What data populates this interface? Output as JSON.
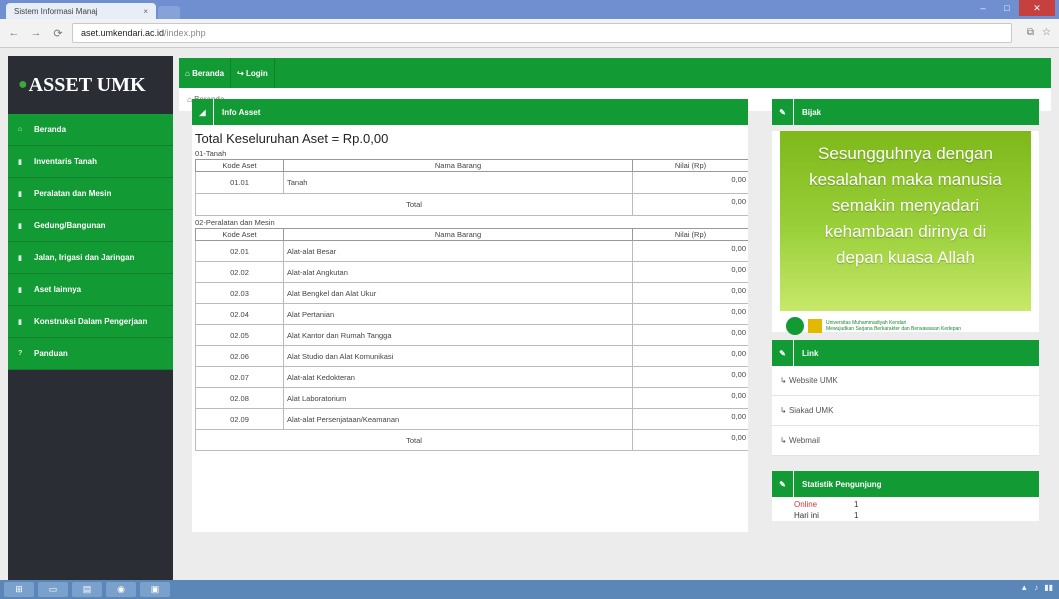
{
  "browser": {
    "tab_title": "Sistem Informasi Manaj",
    "tab_close": "×",
    "url_host": "aset.umkendari.ac.id",
    "url_path": "/index.php"
  },
  "sidebar": {
    "brand": "ASSET UMK",
    "items": [
      {
        "label": "Beranda"
      },
      {
        "label": "Inventaris Tanah"
      },
      {
        "label": "Peralatan dan Mesin"
      },
      {
        "label": "Gedung/Bangunan"
      },
      {
        "label": "Jalan, Irigasi dan Jaringan"
      },
      {
        "label": "Aset lainnya"
      },
      {
        "label": "Konstruksi Dalam Pengerjaan"
      },
      {
        "label": "Panduan"
      }
    ]
  },
  "topnav": {
    "items": [
      {
        "label": "Beranda"
      },
      {
        "label": "Login"
      }
    ]
  },
  "breadcrumb": "Beranda",
  "main": {
    "panel_title": "Info Asset",
    "total_title": "Total Keseluruhan Aset = Rp.0,00",
    "sections": [
      {
        "label": "01-Tanah",
        "headers": [
          "Kode Aset",
          "Nama Barang",
          "Nilai (Rp)"
        ],
        "rows": [
          {
            "kode": "01.01",
            "nama": "Tanah",
            "nilai": "0,00"
          }
        ],
        "total_label": "Total",
        "total_value": "0,00"
      },
      {
        "label": "02-Peralatan dan Mesin",
        "headers": [
          "Kode Aset",
          "Nama Barang",
          "Nilai (Rp)"
        ],
        "rows": [
          {
            "kode": "02.01",
            "nama": "Alat-alat Besar",
            "nilai": "0,00"
          },
          {
            "kode": "02.02",
            "nama": "Alat-alat Angkutan",
            "nilai": "0,00"
          },
          {
            "kode": "02.03",
            "nama": "Alat Bengkel dan Alat Ukur",
            "nilai": "0,00"
          },
          {
            "kode": "02.04",
            "nama": "Alat Pertanian",
            "nilai": "0,00"
          },
          {
            "kode": "02.05",
            "nama": "Alat Kantor dan Rumah Tangga",
            "nilai": "0,00"
          },
          {
            "kode": "02.06",
            "nama": "Alat Studio dan Alat Komunikasi",
            "nilai": "0,00"
          },
          {
            "kode": "02.07",
            "nama": "Alat-alat Kedokteran",
            "nilai": "0,00"
          },
          {
            "kode": "02.08",
            "nama": "Alat Laboratorium",
            "nilai": "0,00"
          },
          {
            "kode": "02.09",
            "nama": "Alat-alat Persenjataan/Keamanan",
            "nilai": "0,00"
          }
        ],
        "total_label": "Total",
        "total_value": "0,00"
      }
    ]
  },
  "right": {
    "info_title": "Bijak",
    "quote_lines": [
      "Sesungguhnya dengan",
      "kesalahan maka manusia",
      "semakin menyadari",
      "kehambaan dirinya di",
      "depan kuasa Allah"
    ],
    "logo_text_1": "Universitas Muhammadiyah Kendari",
    "logo_text_2": "Mewujudkan Sarjana Berkarakter dan Berwawasan Kedepan",
    "link_title": "Link",
    "links": [
      {
        "label": "Website UMK"
      },
      {
        "label": "Siakad UMK"
      },
      {
        "label": "Webmail"
      }
    ],
    "stats_title": "Statistik Pengunjung",
    "stats": [
      {
        "label": "Online",
        "value": "1"
      },
      {
        "label": "Hari ini",
        "value": "1"
      }
    ]
  },
  "colors": {
    "brand_green": "#129a34",
    "sidebar_dark": "#2b2d35"
  }
}
